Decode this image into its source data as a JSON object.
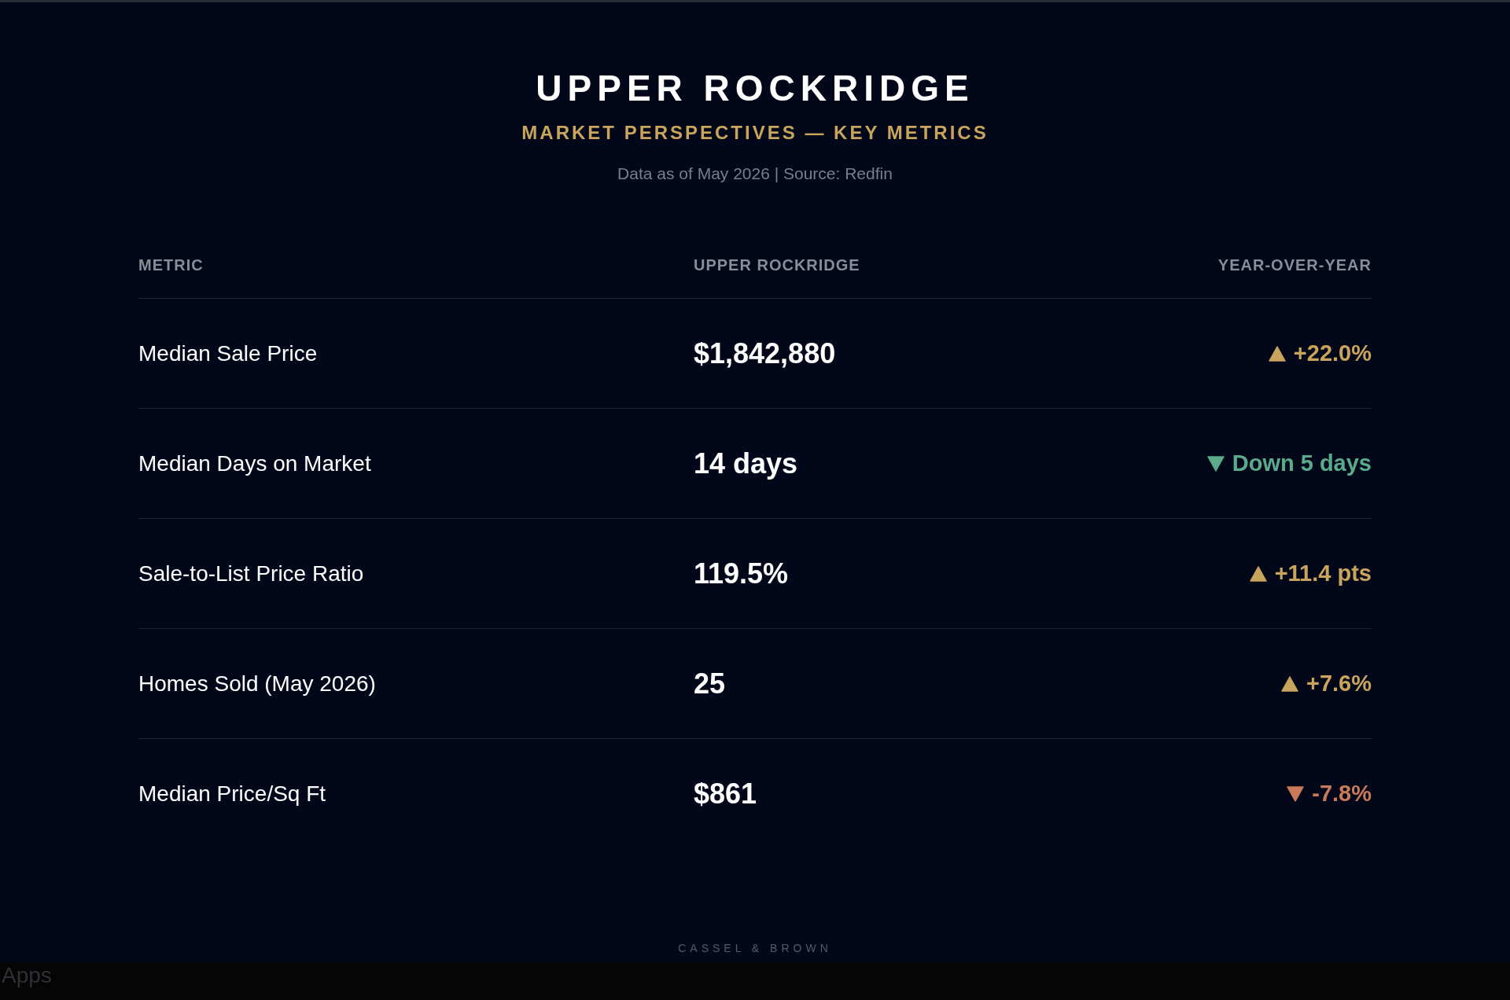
{
  "header": {
    "title": "UPPER ROCKRIDGE",
    "subtitle": "MARKET PERSPECTIVES — KEY METRICS",
    "meta": "Data as of May 2026 | Source: Redfin"
  },
  "table": {
    "columns": [
      "METRIC",
      "UPPER ROCKRIDGE",
      "YEAR-OVER-YEAR"
    ],
    "rows": [
      {
        "metric": "Median Sale Price",
        "value": "$1,842,880",
        "change": "+22.0%",
        "kind": "up",
        "color": "#c9a45c"
      },
      {
        "metric": "Median Days on Market",
        "value": "14 days",
        "change": "Down 5 days",
        "kind": "down",
        "color": "#5aaa8c"
      },
      {
        "metric": "Sale-to-List Price Ratio",
        "value": "119.5%",
        "change": "+11.4 pts",
        "kind": "up",
        "color": "#c9a45c"
      },
      {
        "metric": "Homes Sold (May 2026)",
        "value": "25",
        "change": "+7.6%",
        "kind": "up",
        "color": "#c9a45c"
      },
      {
        "metric": "Median Price/Sq Ft",
        "value": "$861",
        "change": "-7.8%",
        "kind": "down",
        "color": "#c97a58"
      }
    ]
  },
  "footer": "CASSEL & BROWN",
  "taskbar": {
    "apps_label": "Apps"
  }
}
